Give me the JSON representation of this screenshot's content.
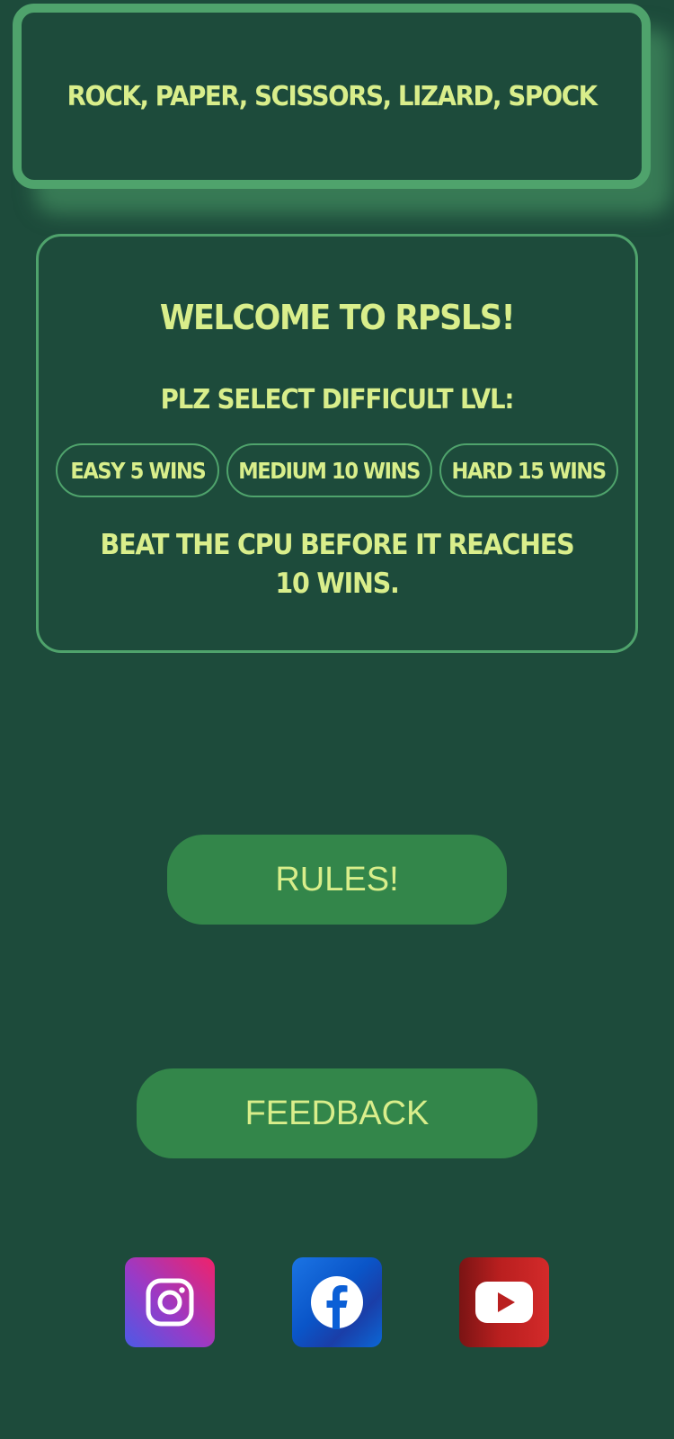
{
  "header": {
    "title": "ROCK, PAPER, SCISSORS, LIZARD, SPOCK"
  },
  "card": {
    "welcome": "WELCOME TO RPSLS!",
    "subtitle": "PLZ SELECT DIFFICULT LVL:",
    "difficulties": [
      {
        "label": "EASY 5 WINS"
      },
      {
        "label": "MEDIUM 10 WINS"
      },
      {
        "label": "HARD 15 WINS"
      }
    ],
    "note": "BEAT THE CPU BEFORE IT REACHES 10 WINS."
  },
  "buttons": {
    "rules_label": "RULES!",
    "feedback_label": "FEEDBACK"
  },
  "social": [
    {
      "icon": "instagram-icon"
    },
    {
      "icon": "facebook-icon"
    },
    {
      "icon": "youtube-icon"
    }
  ],
  "colors": {
    "background": "#1d4b3b",
    "accent_border": "#4fa36c",
    "text": "#d9ee8b",
    "button_fill": "#33864a"
  }
}
